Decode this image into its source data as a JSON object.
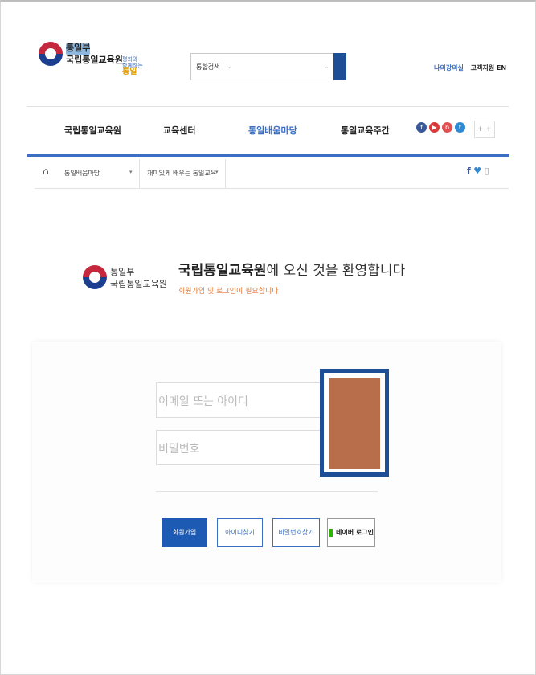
{
  "header": {
    "logo_line1": "통일부",
    "logo_line2": "국립통일교육원",
    "slogan_line1": "평화와",
    "slogan_line2": "함께하는",
    "slogan_highlight": "통일",
    "search": {
      "category": "통합검색",
      "placeholder": ""
    },
    "util": {
      "link1": "나의강의실",
      "link2": "고객지원",
      "link3": "EN"
    }
  },
  "nav": {
    "items": [
      {
        "label": "국립통일교육원"
      },
      {
        "label": "교육센터"
      },
      {
        "label": "통일배움마당"
      },
      {
        "label": "통일교육주간"
      }
    ],
    "more": "+ +"
  },
  "breadcrumb": {
    "home": "⌂",
    "level1": "통일배움마당",
    "level2": "재미있게 배우는 통일교육"
  },
  "welcome": {
    "logo_line1": "통일부",
    "logo_line2": "국립통일교육원",
    "title_bold": "국립통일교육원",
    "title_rest": "에 오신 것을 환영합니다",
    "subtitle": "회원가입 및 로그인이 필요합니다"
  },
  "login": {
    "id_placeholder": "이메일 또는 아이디",
    "pw_placeholder": "비밀번호",
    "buttons": {
      "join": "회원가입",
      "find_id": "아이디찾기",
      "find_pw": "비밀번호찾기",
      "naver": "네이버 로그인"
    }
  }
}
